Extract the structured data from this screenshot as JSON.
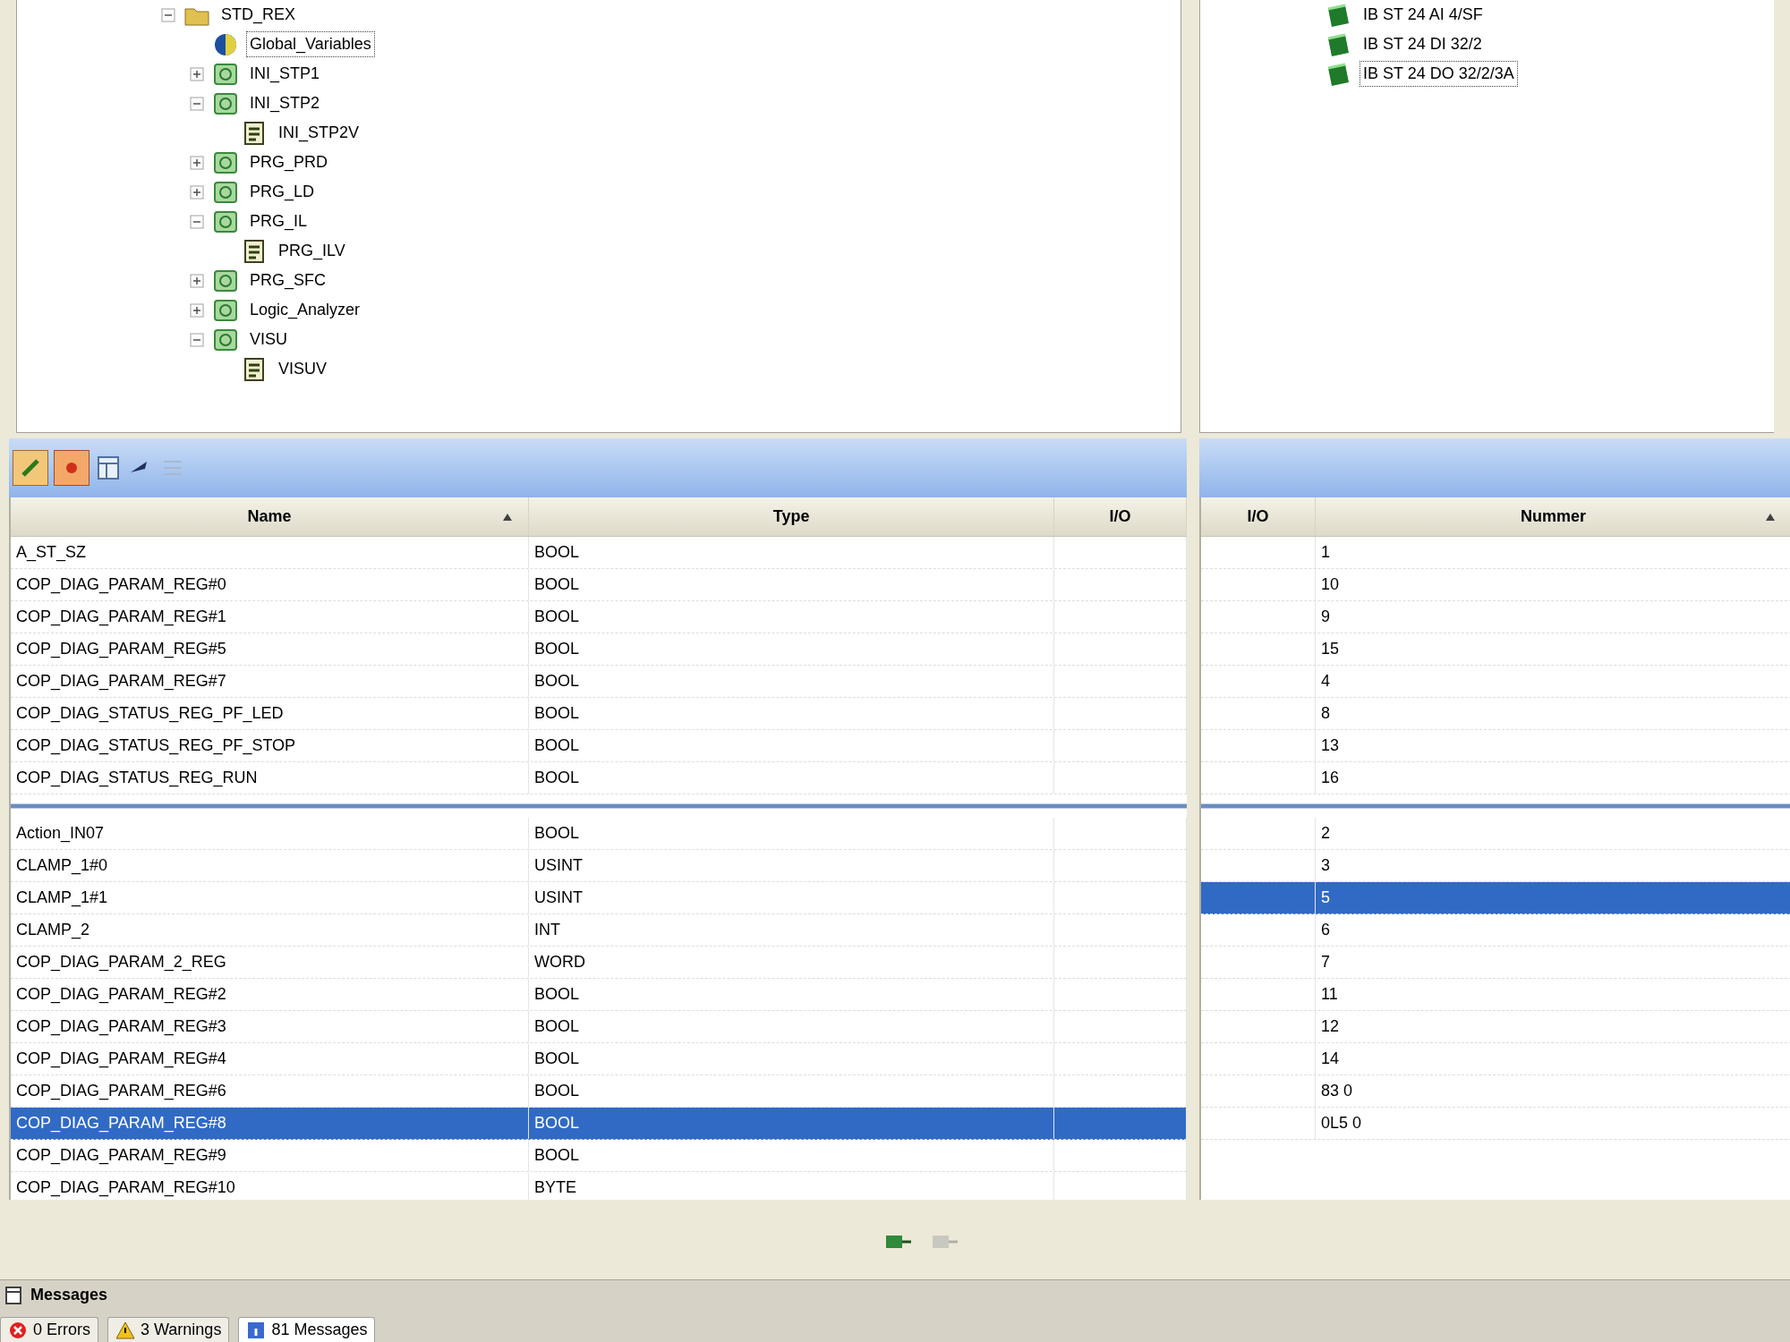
{
  "project_tree": [
    {
      "label": "STD_REX",
      "kind": "folder",
      "expanded": true,
      "selected": false,
      "children": [
        {
          "label": "Global_Variables",
          "kind": "globe",
          "selected": true
        },
        {
          "label": "INI_STP1",
          "kind": "program",
          "expanded": false,
          "selected": false
        },
        {
          "label": "INI_STP2",
          "kind": "program",
          "expanded": true,
          "selected": false,
          "children": [
            {
              "label": "INI_STP2V",
              "kind": "sheet",
              "selected": false
            }
          ]
        },
        {
          "label": "PRG_PRD",
          "kind": "program",
          "expanded": false,
          "selected": false
        },
        {
          "label": "PRG_LD",
          "kind": "program",
          "expanded": false,
          "selected": false
        },
        {
          "label": "PRG_IL",
          "kind": "program",
          "expanded": true,
          "selected": false,
          "children": [
            {
              "label": "PRG_ILV",
              "kind": "sheet",
              "selected": false
            }
          ]
        },
        {
          "label": "PRG_SFC",
          "kind": "program",
          "expanded": false,
          "selected": false
        },
        {
          "label": "Logic_Analyzer",
          "kind": "program",
          "expanded": false,
          "selected": false
        },
        {
          "label": "VISU",
          "kind": "program",
          "expanded": true,
          "selected": false,
          "children": [
            {
              "label": "VISUV",
              "kind": "sheet",
              "selected": false
            }
          ]
        }
      ]
    }
  ],
  "device_tree": [
    {
      "label": "IB ST 24 AI 4/SF",
      "selected": false
    },
    {
      "label": "IB ST 24 DI 32/2",
      "selected": false
    },
    {
      "label": "IB ST 24 DO 32/2/3A",
      "selected": true
    }
  ],
  "variables_table": {
    "columns": [
      {
        "label": "Name",
        "sorted": true
      },
      {
        "label": "Type",
        "sorted": false
      },
      {
        "label": "I/O",
        "sorted": false
      }
    ],
    "groups": [
      [
        {
          "name": "A_ST_SZ",
          "type": "BOOL",
          "selected": false
        },
        {
          "name": "COP_DIAG_PARAM_REG#0",
          "type": "BOOL",
          "selected": false
        },
        {
          "name": "COP_DIAG_PARAM_REG#1",
          "type": "BOOL",
          "selected": false
        },
        {
          "name": "COP_DIAG_PARAM_REG#5",
          "type": "BOOL",
          "selected": false
        },
        {
          "name": "COP_DIAG_PARAM_REG#7",
          "type": "BOOL",
          "selected": false
        },
        {
          "name": "COP_DIAG_STATUS_REG_PF_LED",
          "type": "BOOL",
          "selected": false
        },
        {
          "name": "COP_DIAG_STATUS_REG_PF_STOP",
          "type": "BOOL",
          "selected": false
        },
        {
          "name": "COP_DIAG_STATUS_REG_RUN",
          "type": "BOOL",
          "selected": false
        }
      ],
      [
        {
          "name": "Action_IN07",
          "type": "BOOL",
          "selected": false
        },
        {
          "name": "CLAMP_1#0",
          "type": "USINT",
          "selected": false
        },
        {
          "name": "CLAMP_1#1",
          "type": "USINT",
          "selected": false
        },
        {
          "name": "CLAMP_2",
          "type": "INT",
          "selected": false
        },
        {
          "name": "COP_DIAG_PARAM_2_REG",
          "type": "WORD",
          "selected": false
        },
        {
          "name": "COP_DIAG_PARAM_REG#2",
          "type": "BOOL",
          "selected": false
        },
        {
          "name": "COP_DIAG_PARAM_REG#3",
          "type": "BOOL",
          "selected": false
        },
        {
          "name": "COP_DIAG_PARAM_REG#4",
          "type": "BOOL",
          "selected": false
        },
        {
          "name": "COP_DIAG_PARAM_REG#6",
          "type": "BOOL",
          "selected": false
        },
        {
          "name": "COP_DIAG_PARAM_REG#8",
          "type": "BOOL",
          "selected": true
        },
        {
          "name": "COP_DIAG_PARAM_REG#9",
          "type": "BOOL",
          "selected": false
        },
        {
          "name": "COP_DIAG_PARAM_REG#10",
          "type": "BYTE",
          "selected": false
        }
      ]
    ]
  },
  "io_table": {
    "columns": [
      {
        "label": "I/O",
        "sorted": false
      },
      {
        "label": "Nummer",
        "sorted": true
      }
    ],
    "groups": [
      [
        {
          "number": "1",
          "selected": false
        },
        {
          "number": "10",
          "selected": false
        },
        {
          "number": "9",
          "selected": false
        },
        {
          "number": "15",
          "selected": false
        },
        {
          "number": "4",
          "selected": false
        },
        {
          "number": "8",
          "selected": false
        },
        {
          "number": "13",
          "selected": false
        },
        {
          "number": "16",
          "selected": false
        }
      ],
      [
        {
          "number": "2",
          "selected": false
        },
        {
          "number": "3",
          "selected": false
        },
        {
          "number": "5",
          "selected": true
        },
        {
          "number": "6",
          "selected": false
        },
        {
          "number": "7",
          "selected": false
        },
        {
          "number": "11",
          "selected": false
        },
        {
          "number": "12",
          "selected": false
        },
        {
          "number": "14",
          "selected": false
        },
        {
          "number": "83 0",
          "selected": false
        },
        {
          "number": "0L5 0",
          "selected": false
        }
      ]
    ]
  },
  "messages": {
    "title": "Messages",
    "tabs": [
      {
        "label": "0 Errors",
        "kind": "error",
        "selected": false
      },
      {
        "label": "3 Warnings",
        "kind": "warning",
        "selected": false
      },
      {
        "label": "81 Messages",
        "kind": "info",
        "selected": true
      }
    ]
  }
}
